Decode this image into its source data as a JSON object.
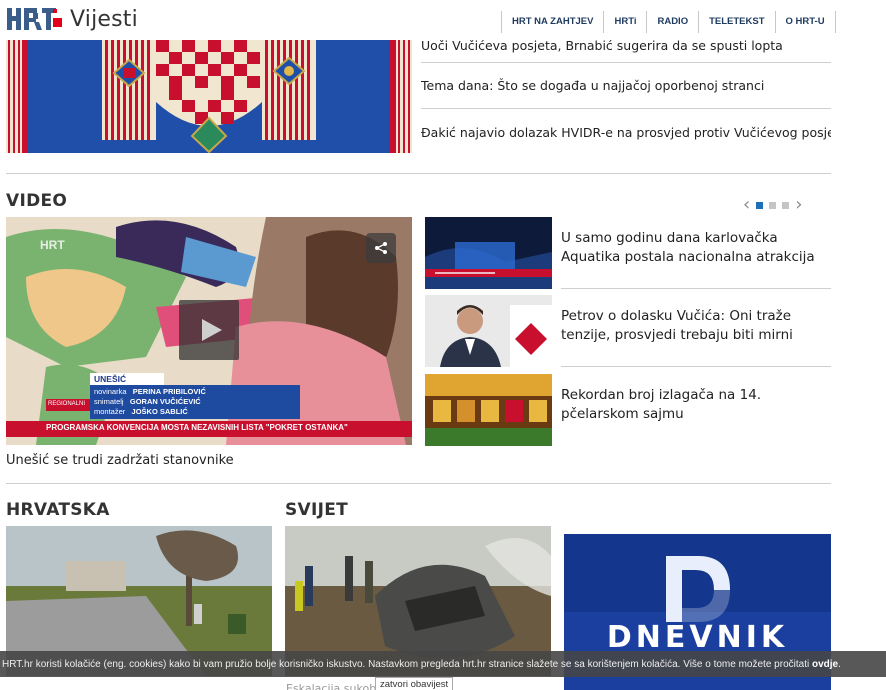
{
  "header": {
    "logo_text": "Vijesti",
    "nav": [
      "HRT NA ZAHTJEV",
      "HRTi",
      "RADIO",
      "TELETEKST",
      "O HRT-U"
    ]
  },
  "top_news": [
    "Uoči Vučićeva posjeta, Brnabić sugerira da se spusti lopta",
    "Tema dana: Što se događa u najjačoj oporbenoj stranci",
    "Đakić najavio dolazak HVIDR-e na prosvjed protiv Vučićevog posjeta"
  ],
  "video": {
    "section_title": "VIDEO",
    "main": {
      "caption": "Unešić se trudi zadržati stanovnike",
      "overlay": {
        "place": "UNEŠIĆ",
        "credits": [
          {
            "role": "novinarka",
            "name": "PERINA PRIBILOVIĆ"
          },
          {
            "role": "snimatelj",
            "name": "GORAN VUČIĆEVIĆ"
          },
          {
            "role": "montažer",
            "name": "JOŠKO SABLIĆ"
          }
        ],
        "badge": "REGIONALNI",
        "ticker": "PROGRAMSKA KONVENCIJA MOSTA NEZAVISNIH LISTA \"POKRET OSTANKA\""
      }
    },
    "side": [
      {
        "title": "U samo godinu dana karlovačka Aquatika postala nacionalna atrakcija"
      },
      {
        "title": "Petrov o dolasku Vučića: Oni traže tenzije, prosvjedi trebaju biti mirni"
      },
      {
        "title": "Rekordan broj izlagača na 14. pčelarskom sajmu"
      }
    ],
    "carousel": {
      "pages": 3,
      "active": 1
    }
  },
  "sections": {
    "hrvatska": "HRVATSKA",
    "svijet": "SVIJET"
  },
  "dnevnik_label": "DNEVNIK",
  "cookie": {
    "text": "HRT.hr koristi kolačiće (eng. cookies) kako bi vam pružio bolje korisničko iskustvo. Nastavkom pregleda hrt.hr stranice slažete se sa korištenjem kolačića. Više o tome možete pročitati ",
    "link": "ovdje",
    "end": ".",
    "button": "zatvori obavijest"
  },
  "colors": {
    "nav_text": "#1e3a5f",
    "accent_blue": "#1e6fb5",
    "brand_red": "#e2001a",
    "dnevnik_blue": "#14368d"
  }
}
